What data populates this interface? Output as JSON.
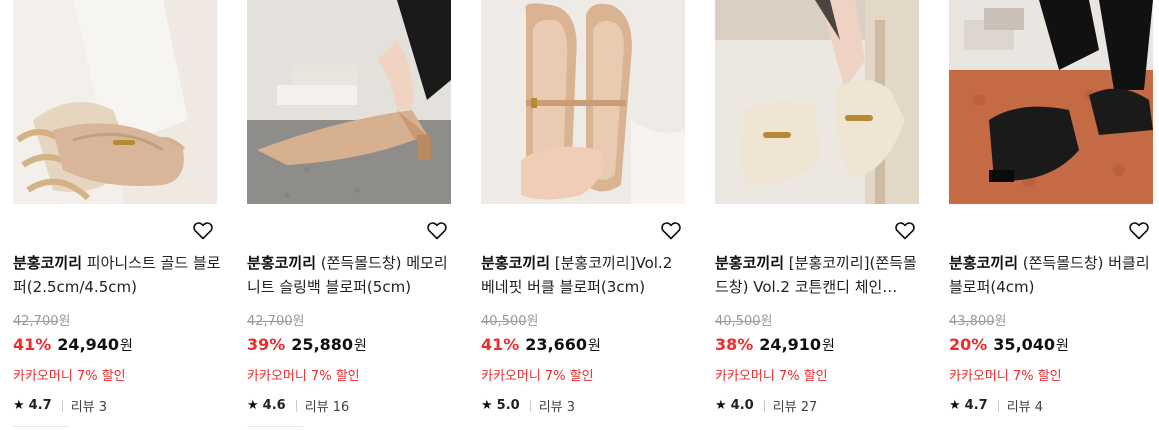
{
  "products": [
    {
      "brand": "분홍코끼리",
      "title": " 피아니스트 골드 블로퍼(2.5cm/4.5cm)",
      "original_price": "42,700",
      "discount_rate": "41%",
      "sale_price": "24,940",
      "won": "원",
      "promo": "카카오머니 7% 할인",
      "rating": "4.7",
      "review_label": "리뷰 3"
    },
    {
      "brand": "분홍코끼리",
      "title": " (쫀득몰드창) 메모리 니트 슬링백 블로퍼(5cm)",
      "original_price": "42,700",
      "discount_rate": "39%",
      "sale_price": "25,880",
      "won": "원",
      "promo": "카카오머니 7% 할인",
      "rating": "4.6",
      "review_label": "리뷰 16"
    },
    {
      "brand": "분홍코끼리",
      "title": " [분홍코끼리]Vol.2 베네핏 버클 블로퍼(3cm)",
      "original_price": "40,500",
      "discount_rate": "41%",
      "sale_price": "23,660",
      "won": "원",
      "promo": "카카오머니 7% 할인",
      "rating": "5.0",
      "review_label": "리뷰 3"
    },
    {
      "brand": "분홍코끼리",
      "title": " [분홍코끼리](쫀득몰드창) Vol.2 코튼캔디 체인…",
      "original_price": "40,500",
      "discount_rate": "38%",
      "sale_price": "24,910",
      "won": "원",
      "promo": "카카오머니 7% 할인",
      "rating": "4.0",
      "review_label": "리뷰 27"
    },
    {
      "brand": "분홍코끼리",
      "title": " (쫀득몰드창) 버클리 블로퍼(4cm)",
      "original_price": "43,800",
      "discount_rate": "20%",
      "sale_price": "35,040",
      "won": "원",
      "promo": "카카오머니 7% 할인",
      "rating": "4.7",
      "review_label": "리뷰 4"
    }
  ],
  "colors": {
    "discount": "#ee2c2c",
    "promo": "#ee2c2c",
    "strike": "#9a9a9a"
  },
  "icons": {
    "wishlist": "heart-outline-icon",
    "rating": "star-icon"
  }
}
